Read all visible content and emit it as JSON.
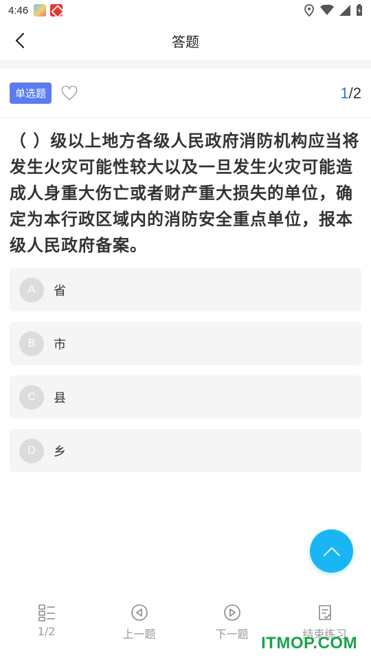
{
  "status_bar": {
    "time": "4:46"
  },
  "header": {
    "title": "答题"
  },
  "question": {
    "type_badge": "单选题",
    "current": "1",
    "total_sep": "/2",
    "text": "（ ）级以上地方各级人民政府消防机构应当将发生火灾可能性较大以及一旦发生火灾可能造成人身重大伤亡或者财产重大损失的单位，确定为本行政区域内的消防安全重点单位，报本级人民政府备案。"
  },
  "options": [
    {
      "letter": "A",
      "text": "省"
    },
    {
      "letter": "B",
      "text": "市"
    },
    {
      "letter": "C",
      "text": "县"
    },
    {
      "letter": "D",
      "text": "乡"
    }
  ],
  "bottom_nav": [
    {
      "label": "1/2",
      "icon": "grid-list-icon"
    },
    {
      "label": "上一题",
      "icon": "previous-icon"
    },
    {
      "label": "下一题",
      "icon": "next-icon"
    },
    {
      "label": "结束练习",
      "icon": "finish-icon"
    }
  ],
  "watermark": "ITMOP.COM",
  "colors": {
    "accent": "#5a7cf0",
    "fab": "#1ab6f4",
    "counter": "#3a6ee8"
  }
}
